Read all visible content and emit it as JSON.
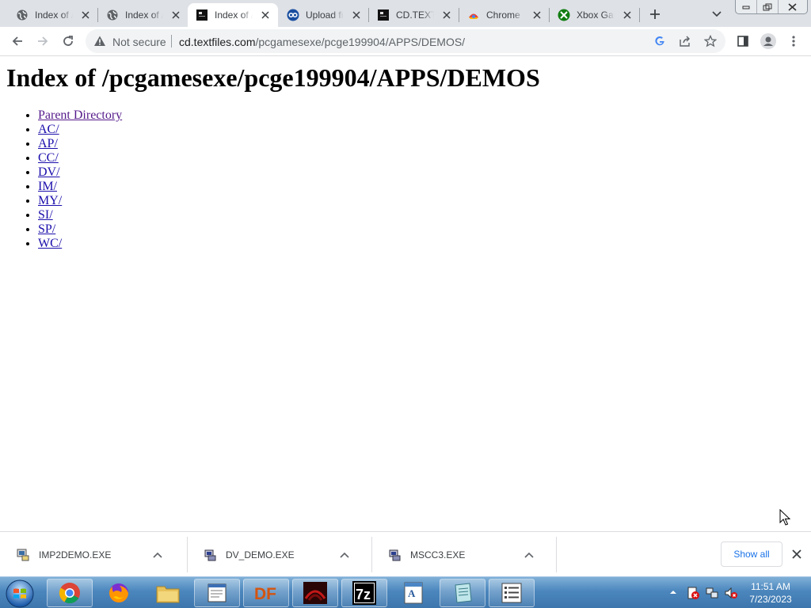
{
  "tabs": [
    {
      "title": "Index of /pcgamesexe",
      "favicon": "globe-icon",
      "active": false
    },
    {
      "title": "Index of /pcgamesexe",
      "favicon": "globe-icon",
      "active": false
    },
    {
      "title": "Index of /pcgamesexe",
      "favicon": "textfiles-icon",
      "active": true
    },
    {
      "title": "Upload files",
      "favicon": "upload-icon",
      "active": false
    },
    {
      "title": "CD.TEXTFILES",
      "favicon": "textfiles-icon",
      "active": false
    },
    {
      "title": "Chrome",
      "favicon": "chrome-icon",
      "active": false
    },
    {
      "title": "Xbox Game",
      "favicon": "xbox-icon",
      "active": false
    }
  ],
  "omnibox": {
    "security": "Not secure",
    "host": "cd.textfiles.com",
    "path": "/pcgamesexe/pcge199904/APPS/DEMOS/"
  },
  "page": {
    "heading": "Index of /pcgamesexe/pcge199904/APPS/DEMOS",
    "links": [
      "Parent Directory",
      "AC/",
      "AP/",
      "CC/",
      "DV/",
      "IM/",
      "MY/",
      "SI/",
      "SP/",
      "WC/"
    ]
  },
  "downloads": {
    "items": [
      {
        "name": "IMP2DEMO.EXE",
        "icon": "installer-icon"
      },
      {
        "name": "DV_DEMO.EXE",
        "icon": "setup-icon"
      },
      {
        "name": "MSCC3.EXE",
        "icon": "setup-icon"
      }
    ],
    "show_all": "Show all"
  },
  "taskbar": {
    "apps": [
      "chrome",
      "firefox",
      "file-explorer",
      "notepad",
      "df",
      "game",
      "7-zip",
      "wordpad",
      "notepad-alt",
      "list-app"
    ],
    "time": "11:51 AM",
    "date": "7/23/2023"
  },
  "colors": {
    "link": "#1a0dab",
    "visited_link": "#551a8b",
    "tabstrip": "#dee1e6",
    "accent": "#1a73e8"
  }
}
